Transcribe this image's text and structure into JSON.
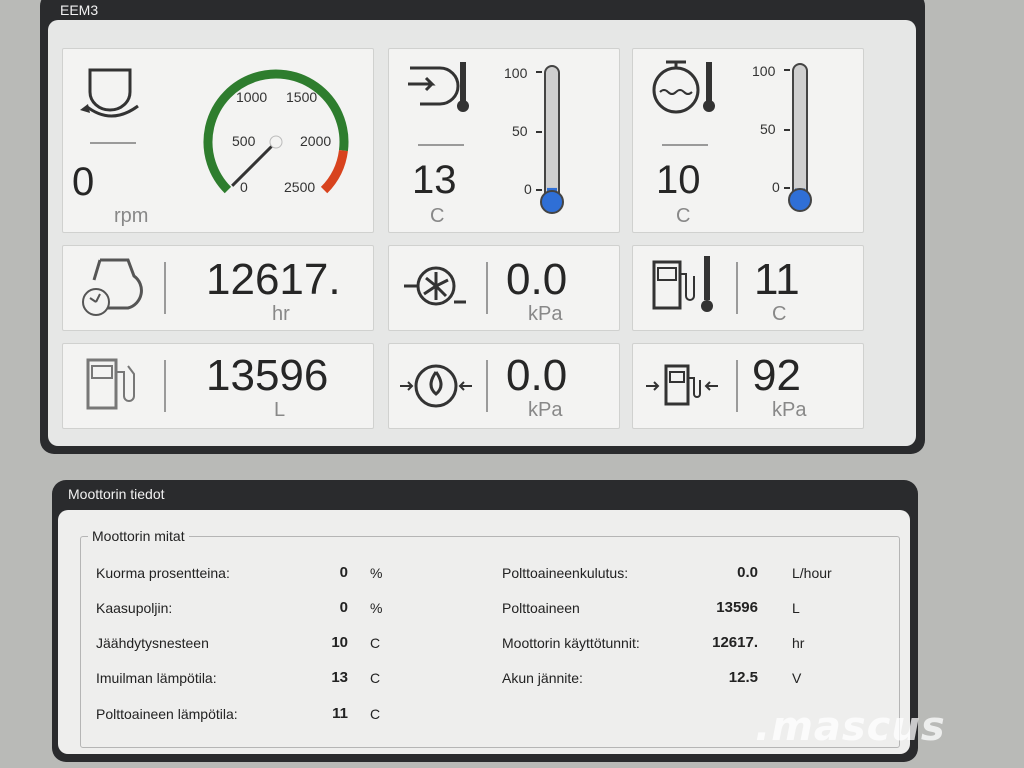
{
  "window": {
    "title": "EEM3"
  },
  "gauges": {
    "rpm": {
      "value": "0",
      "unit": "rpm",
      "ticks": [
        "500",
        "1000",
        "1500",
        "2000",
        "2500",
        "0"
      ],
      "needle_rpm": 0,
      "max_rpm": 2500
    },
    "intake_temp": {
      "value": "13",
      "unit": "C",
      "level_percent": 8,
      "scale": [
        "100",
        "50",
        "0"
      ]
    },
    "coolant_temp": {
      "value": "10",
      "unit": "C",
      "level_percent": 6,
      "scale": [
        "100",
        "50",
        "0"
      ]
    },
    "engine_hours": {
      "value": "12617.",
      "unit": "hr"
    },
    "boost_pressure": {
      "value": "0.0",
      "unit": "kPa"
    },
    "fuel_temp": {
      "value": "11",
      "unit": "C"
    },
    "fuel_used": {
      "value": "13596",
      "unit": "L"
    },
    "oil_pressure": {
      "value": "0.0",
      "unit": "kPa"
    },
    "fuel_pressure": {
      "value": "92",
      "unit": "kPa"
    }
  },
  "details": {
    "title": "Moottorin tiedot",
    "group_title": "Moottorin mitat",
    "left_rows": [
      {
        "label": "Kuorma prosentteina:",
        "value": "0",
        "unit": "%"
      },
      {
        "label": "Kaasupoljin:",
        "value": "0",
        "unit": "%"
      },
      {
        "label": "Jäähdytysnesteen",
        "value": "10",
        "unit": "C"
      },
      {
        "label": "Imuilman lämpötila:",
        "value": "13",
        "unit": "C"
      },
      {
        "label": "Polttoaineen lämpötila:",
        "value": "11",
        "unit": "C"
      }
    ],
    "right_rows": [
      {
        "label": "Polttoaineenkulutus:",
        "value": "0.0",
        "unit": "L/hour"
      },
      {
        "label": "Polttoaineen",
        "value": "13596",
        "unit": "L"
      },
      {
        "label": "Moottorin käyttötunnit:",
        "value": "12617.",
        "unit": "hr"
      },
      {
        "label": "Akun jännite:",
        "value": "12.5",
        "unit": "V"
      }
    ]
  },
  "watermark": ".mascus",
  "colors": {
    "gauge_green": "#2e7d2e",
    "gauge_red": "#d8431e",
    "thermo_blue": "#2f6fd6"
  }
}
